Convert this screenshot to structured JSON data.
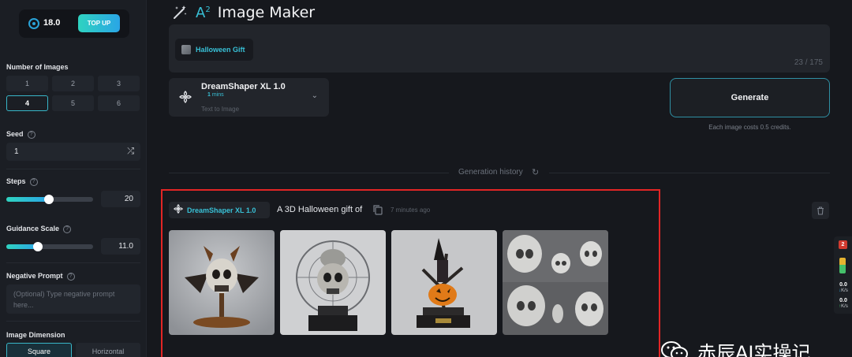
{
  "sidebar": {
    "credits": "18.0",
    "top_up_label": "TOP UP",
    "number_of_images": {
      "label": "Number of Images",
      "options": [
        "1",
        "2",
        "3",
        "4",
        "5",
        "6"
      ],
      "selected": "4"
    },
    "seed": {
      "label": "Seed",
      "value": "1"
    },
    "steps": {
      "label": "Steps",
      "value": "20",
      "fraction": 0.49
    },
    "guidance_scale": {
      "label": "Guidance Scale",
      "value": "11.0",
      "fraction": 0.36
    },
    "negative_prompt": {
      "label": "Negative Prompt",
      "placeholder": "(Optional) Type negative prompt here..."
    },
    "image_dimension": {
      "label": "Image Dimension",
      "options": [
        "Square",
        "Horizontal"
      ],
      "selected": "Square"
    }
  },
  "header": {
    "logo_text": "A",
    "logo_sup": "2",
    "title": "Image Maker"
  },
  "prompt": {
    "tag_label": "Halloween Gift",
    "char_count": "23 / 175"
  },
  "model": {
    "name": "DreamShaper XL 1.0",
    "mins_value": "1",
    "mins_unit": "mins",
    "type": "Text to Image"
  },
  "generate": {
    "label": "Generate",
    "cost_note": "Each image costs 0.5 credits."
  },
  "history": {
    "label": "Generation history",
    "entry": {
      "model": "DreamShaper XL 1.0",
      "prompt": "A 3D Halloween gift of",
      "time_ago": "7 minutes ago",
      "images": [
        "skull-bat-figurine",
        "skull-pumpkin-trophy",
        "witch-pumpkin-tree",
        "skull-sculpture-grid"
      ]
    }
  },
  "widget": {
    "badge": "2",
    "down_value": "0.0",
    "down_unit": "K/s",
    "up_value": "0.0",
    "up_unit": "K/s"
  },
  "watermark": {
    "text": "赤辰AI实操记"
  },
  "colors": {
    "accent": "#38c0d6",
    "background": "#16181d",
    "panel": "#22252b",
    "highlight_frame": "#e22525"
  }
}
